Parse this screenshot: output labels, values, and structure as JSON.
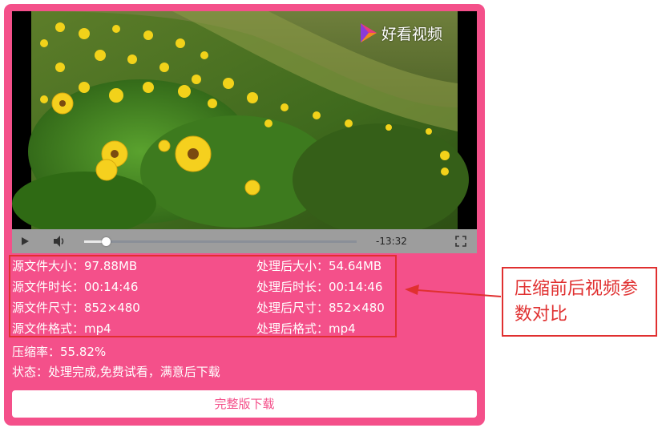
{
  "player": {
    "watermark": "好看视频",
    "time_remaining": "-13:32",
    "progress_fraction": 0.08
  },
  "stats": {
    "left": [
      {
        "label": "源文件大小：",
        "value": "97.88MB"
      },
      {
        "label": "源文件时长：",
        "value": "00:14:46"
      },
      {
        "label": "源文件尺寸：",
        "value": "852×480"
      },
      {
        "label": "源文件格式：",
        "value": "mp4"
      }
    ],
    "right": [
      {
        "label": "处理后大小：",
        "value": "54.64MB"
      },
      {
        "label": "处理后时长：",
        "value": "00:14:46"
      },
      {
        "label": "处理后尺寸：",
        "value": "852×480"
      },
      {
        "label": "处理后格式：",
        "value": "mp4"
      }
    ]
  },
  "compression_rate": "压缩率：55.82%",
  "status_line": "状态：处理完成,免费试看，满意后下载",
  "download_button": "完整版下载",
  "annotation": "压缩前后视频参数对比",
  "colors": {
    "card": "#f4508a",
    "annotation_red": "#e03030",
    "button_text": "#f4508a"
  }
}
